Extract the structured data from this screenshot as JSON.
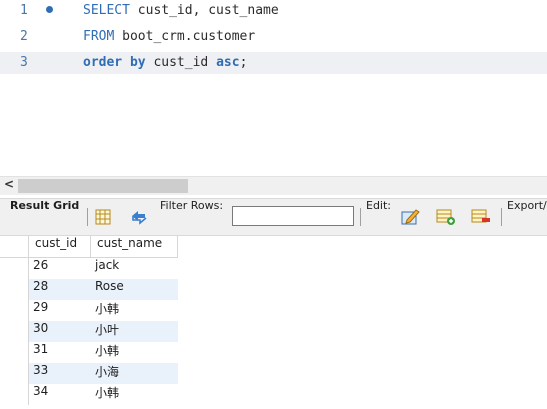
{
  "editor": {
    "lines": [
      {
        "num": "1",
        "parts": [
          {
            "t": "SELECT",
            "k": "kw"
          },
          {
            "t": " cust_id, cust_name",
            "k": ""
          }
        ]
      },
      {
        "num": "2",
        "parts": [
          {
            "t": "FROM",
            "k": "kw"
          },
          {
            "t": " boot_crm.customer",
            "k": ""
          }
        ]
      },
      {
        "num": "3",
        "parts": [
          {
            "t": "order by",
            "k": "kw-bold"
          },
          {
            "t": " cust_id ",
            "k": ""
          },
          {
            "t": "asc",
            "k": "kw-bold"
          },
          {
            "t": ";",
            "k": ""
          }
        ]
      }
    ]
  },
  "scrollbar": {
    "left_arrow": "<"
  },
  "toolbar": {
    "result_grid_label": "Result Grid",
    "filter_label": "Filter Rows:",
    "filter_value": "",
    "edit_label": "Edit:",
    "export_label": "Export/"
  },
  "grid": {
    "columns": [
      "cust_id",
      "cust_name"
    ],
    "rows": [
      [
        "26",
        "jack"
      ],
      [
        "28",
        "Rose"
      ],
      [
        "29",
        "小韩"
      ],
      [
        "30",
        "小叶"
      ],
      [
        "31",
        "小韩"
      ],
      [
        "33",
        "小海"
      ],
      [
        "34",
        "小韩"
      ]
    ]
  },
  "colors": {
    "keyword": "#2f6db5",
    "row_alt": "#e9f1fb",
    "line_highlight": "#eef0f3"
  }
}
